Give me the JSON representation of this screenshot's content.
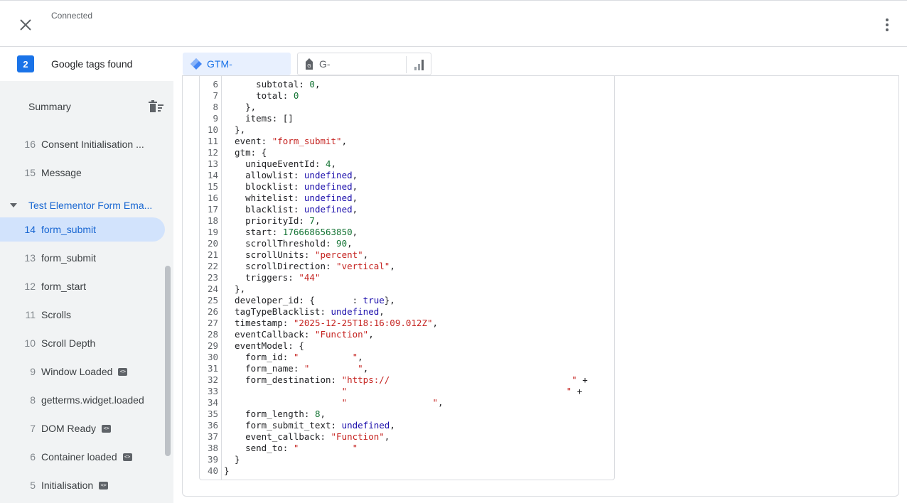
{
  "header": {
    "status": "Connected"
  },
  "tagbar": {
    "count": "2",
    "label": "Google tags found",
    "tags": [
      {
        "label": "GTM-",
        "selected": true
      },
      {
        "label": "G-",
        "selected": false
      }
    ]
  },
  "sidebar": {
    "summary_label": "Summary",
    "events_before": [
      {
        "num": "16",
        "name": "Consent Initialisation ...",
        "badge": false
      },
      {
        "num": "15",
        "name": "Message",
        "badge": false
      }
    ],
    "group_label": "Test Elementor Form Ema...",
    "events_after": [
      {
        "num": "14",
        "name": "form_submit",
        "badge": false,
        "selected": true
      },
      {
        "num": "13",
        "name": "form_submit",
        "badge": false
      },
      {
        "num": "12",
        "name": "form_start",
        "badge": false
      },
      {
        "num": "11",
        "name": "Scrolls",
        "badge": false
      },
      {
        "num": "10",
        "name": "Scroll Depth",
        "badge": false
      },
      {
        "num": "9",
        "name": "Window Loaded",
        "badge": true
      },
      {
        "num": "8",
        "name": "getterms.widget.loaded",
        "badge": false
      },
      {
        "num": "7",
        "name": "DOM Ready",
        "badge": true
      },
      {
        "num": "6",
        "name": "Container loaded",
        "badge": true
      },
      {
        "num": "5",
        "name": "Initialisation",
        "badge": true
      }
    ]
  },
  "code": {
    "lines": [
      {
        "n": "6",
        "parts": [
          [
            "p",
            "      subtotal: "
          ],
          [
            "n",
            "0"
          ],
          [
            "p",
            ","
          ]
        ]
      },
      {
        "n": "7",
        "parts": [
          [
            "p",
            "      total: "
          ],
          [
            "n",
            "0"
          ]
        ]
      },
      {
        "n": "8",
        "parts": [
          [
            "p",
            "    },"
          ]
        ]
      },
      {
        "n": "9",
        "parts": [
          [
            "p",
            "    items: []"
          ]
        ]
      },
      {
        "n": "10",
        "parts": [
          [
            "p",
            "  },"
          ]
        ]
      },
      {
        "n": "11",
        "parts": [
          [
            "p",
            "  event: "
          ],
          [
            "s",
            "\"form_submit\""
          ],
          [
            "p",
            ","
          ]
        ]
      },
      {
        "n": "12",
        "parts": [
          [
            "p",
            "  gtm: {"
          ]
        ]
      },
      {
        "n": "13",
        "parts": [
          [
            "p",
            "    uniqueEventId: "
          ],
          [
            "n",
            "4"
          ],
          [
            "p",
            ","
          ]
        ]
      },
      {
        "n": "14",
        "parts": [
          [
            "p",
            "    allowlist: "
          ],
          [
            "k",
            "undefined"
          ],
          [
            "p",
            ","
          ]
        ]
      },
      {
        "n": "15",
        "parts": [
          [
            "p",
            "    blocklist: "
          ],
          [
            "k",
            "undefined"
          ],
          [
            "p",
            ","
          ]
        ]
      },
      {
        "n": "16",
        "parts": [
          [
            "p",
            "    whitelist: "
          ],
          [
            "k",
            "undefined"
          ],
          [
            "p",
            ","
          ]
        ]
      },
      {
        "n": "17",
        "parts": [
          [
            "p",
            "    blacklist: "
          ],
          [
            "k",
            "undefined"
          ],
          [
            "p",
            ","
          ]
        ]
      },
      {
        "n": "18",
        "parts": [
          [
            "p",
            "    priorityId: "
          ],
          [
            "n",
            "7"
          ],
          [
            "p",
            ","
          ]
        ]
      },
      {
        "n": "19",
        "parts": [
          [
            "p",
            "    start: "
          ],
          [
            "n",
            "1766686563850"
          ],
          [
            "p",
            ","
          ]
        ]
      },
      {
        "n": "20",
        "parts": [
          [
            "p",
            "    scrollThreshold: "
          ],
          [
            "n",
            "90"
          ],
          [
            "p",
            ","
          ]
        ]
      },
      {
        "n": "21",
        "parts": [
          [
            "p",
            "    scrollUnits: "
          ],
          [
            "s",
            "\"percent\""
          ],
          [
            "p",
            ","
          ]
        ]
      },
      {
        "n": "22",
        "parts": [
          [
            "p",
            "    scrollDirection: "
          ],
          [
            "s",
            "\"vertical\""
          ],
          [
            "p",
            ","
          ]
        ]
      },
      {
        "n": "23",
        "parts": [
          [
            "p",
            "    triggers: "
          ],
          [
            "s",
            "\"44\""
          ]
        ]
      },
      {
        "n": "24",
        "parts": [
          [
            "p",
            "  },"
          ]
        ]
      },
      {
        "n": "25",
        "parts": [
          [
            "p",
            "  developer_id: {       : "
          ],
          [
            "k",
            "true"
          ],
          [
            "p",
            "},"
          ]
        ]
      },
      {
        "n": "26",
        "parts": [
          [
            "p",
            "  tagTypeBlacklist: "
          ],
          [
            "k",
            "undefined"
          ],
          [
            "p",
            ","
          ]
        ]
      },
      {
        "n": "27",
        "parts": [
          [
            "p",
            "  timestamp: "
          ],
          [
            "s",
            "\"2025-12-25T18:16:09.012Z\""
          ],
          [
            "p",
            ","
          ]
        ]
      },
      {
        "n": "28",
        "parts": [
          [
            "p",
            "  eventCallback: "
          ],
          [
            "s",
            "\"Function\""
          ],
          [
            "p",
            ","
          ]
        ]
      },
      {
        "n": "29",
        "parts": [
          [
            "p",
            "  eventModel: {"
          ]
        ]
      },
      {
        "n": "30",
        "parts": [
          [
            "p",
            "    form_id: "
          ],
          [
            "s",
            "\"          \""
          ],
          [
            "p",
            ","
          ]
        ]
      },
      {
        "n": "31",
        "parts": [
          [
            "p",
            "    form_name: "
          ],
          [
            "s",
            "\"         \""
          ],
          [
            "p",
            ","
          ]
        ]
      },
      {
        "n": "32",
        "parts": [
          [
            "p",
            "    form_destination: "
          ],
          [
            "s",
            "\"https://                                  \""
          ],
          [
            "p",
            " +"
          ]
        ]
      },
      {
        "n": "33",
        "parts": [
          [
            "p",
            "                      "
          ],
          [
            "s",
            "\"                                         \""
          ],
          [
            "p",
            " +"
          ]
        ]
      },
      {
        "n": "34",
        "parts": [
          [
            "p",
            "                      "
          ],
          [
            "s",
            "\"                \""
          ],
          [
            "p",
            ","
          ]
        ]
      },
      {
        "n": "35",
        "parts": [
          [
            "p",
            "    form_length: "
          ],
          [
            "n",
            "8"
          ],
          [
            "p",
            ","
          ]
        ]
      },
      {
        "n": "36",
        "parts": [
          [
            "p",
            "    form_submit_text: "
          ],
          [
            "k",
            "undefined"
          ],
          [
            "p",
            ","
          ]
        ]
      },
      {
        "n": "37",
        "parts": [
          [
            "p",
            "    event_callback: "
          ],
          [
            "s",
            "\"Function\""
          ],
          [
            "p",
            ","
          ]
        ]
      },
      {
        "n": "38",
        "parts": [
          [
            "p",
            "    send_to: "
          ],
          [
            "s",
            "\"          \""
          ]
        ]
      },
      {
        "n": "39",
        "parts": [
          [
            "p",
            "  }"
          ]
        ]
      },
      {
        "n": "40",
        "parts": [
          [
            "p",
            "}"
          ]
        ]
      }
    ]
  },
  "colors": {
    "accent": "#1a73e8",
    "selected_bg": "#d2e3fc",
    "sidebar_bg": "#f1f3f4"
  },
  "icons": {
    "close": "close-icon",
    "more": "more-vert-icon",
    "gtm": "gtm-diamond-icon",
    "ga_tag": "tag-icon",
    "analytics": "analytics-bars-icon",
    "delete": "delete-sweep-icon"
  }
}
